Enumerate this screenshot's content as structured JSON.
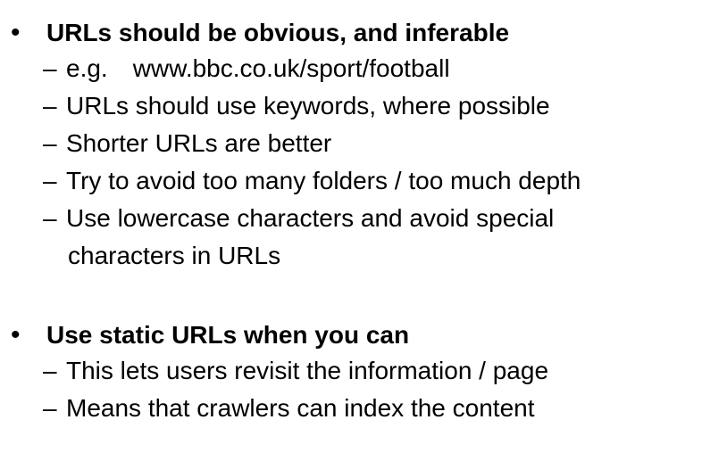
{
  "bullets": [
    {
      "marker": "•",
      "heading": "URLs should be obvious, and inferable",
      "subitems": [
        {
          "dash": "–",
          "label": "e.g.",
          "example": "www.bbc.co.uk/sport/football"
        },
        {
          "dash": "–",
          "text": "URLs should use keywords, where possible"
        },
        {
          "dash": "–",
          "text": "Shorter URLs are better"
        },
        {
          "dash": "–",
          "text": "Try to avoid too many folders / too much depth"
        },
        {
          "dash": "–",
          "text": "Use lowercase characters and avoid special",
          "text_cont": "characters in URLs"
        }
      ]
    },
    {
      "marker": "•",
      "heading": "Use static URLs when you can",
      "subitems": [
        {
          "dash": "–",
          "text": "This lets users revisit the information / page"
        },
        {
          "dash": "–",
          "text": "Means that crawlers can index the content"
        }
      ]
    }
  ]
}
